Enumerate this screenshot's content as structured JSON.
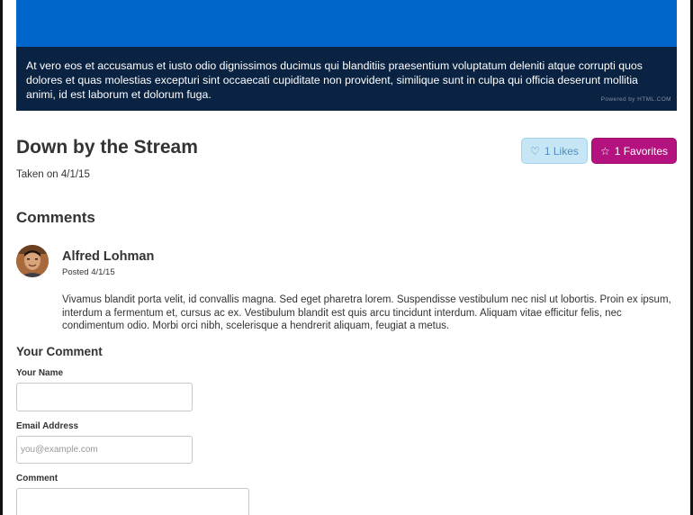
{
  "hero": {
    "color": "#0066cc",
    "caption": "At vero eos et accusamus et iusto odio dignissimos ducimus qui blanditiis praesentium voluptatum deleniti atque corrupti quos dolores et quas molestias excepturi sint occaecati cupiditate non provident, similique sunt in culpa qui officia deserunt mollitia animi, id est laborum et dolorum fuga.",
    "powered_by": "Powered by HTML.COM"
  },
  "photo": {
    "title": "Down by the Stream",
    "taken": "Taken on 4/1/15"
  },
  "actions": {
    "likes_icon": "♡",
    "likes_label": "1 Likes",
    "favorites_icon": "☆",
    "favorites_label": "1 Favorites",
    "likes_color": "#c6e6f6",
    "favorites_color": "#b3127f"
  },
  "comments": {
    "heading": "Comments",
    "items": [
      {
        "name": "Alfred Lohman",
        "posted": "Posted 4/1/15",
        "body": "Vivamus blandit porta velit, id convallis magna. Sed eget pharetra lorem. Suspendisse vestibulum nec nisl ut lobortis. Proin ex ipsum, interdum a fermentum et, cursus ac ex. Vestibulum blandit est quis arcu tincidunt interdum. Aliquam vitae efficitur felis, nec condimentum odio. Morbi orci nibh, scelerisque a hendrerit aliquam, feugiat a metus."
      }
    ]
  },
  "form": {
    "heading": "Your Comment",
    "name_label": "Your Name",
    "name_value": "",
    "email_label": "Email Address",
    "email_placeholder": "you@example.com",
    "comment_label": "Comment"
  }
}
